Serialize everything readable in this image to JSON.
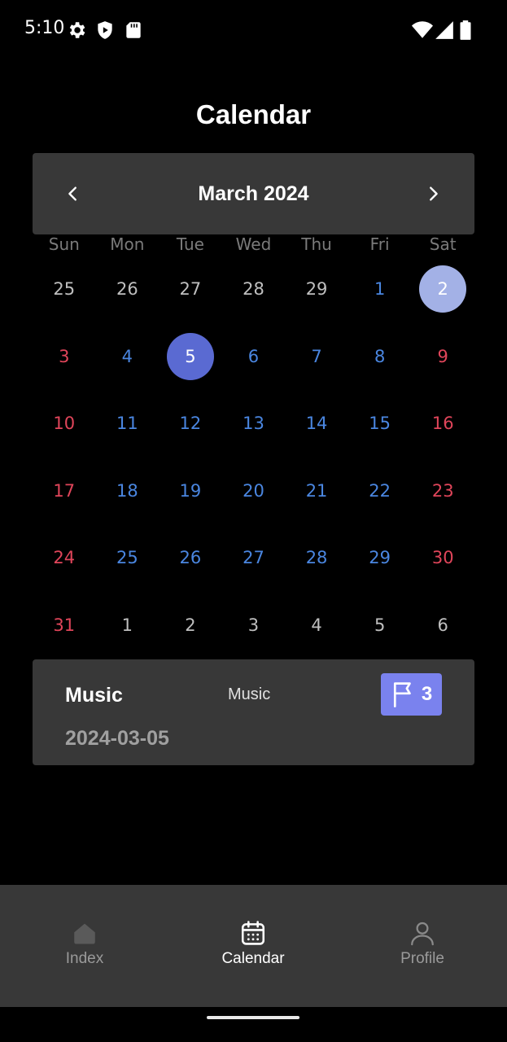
{
  "status_bar": {
    "time": "5:10"
  },
  "page": {
    "title": "Calendar"
  },
  "calendar": {
    "month_label": "March 2024",
    "weekdays": [
      "Sun",
      "Mon",
      "Tue",
      "Wed",
      "Thu",
      "Fri",
      "Sat"
    ],
    "days": [
      {
        "n": "25",
        "c": "grey"
      },
      {
        "n": "26",
        "c": "grey"
      },
      {
        "n": "27",
        "c": "grey"
      },
      {
        "n": "28",
        "c": "grey"
      },
      {
        "n": "29",
        "c": "grey"
      },
      {
        "n": "1",
        "c": "blue"
      },
      {
        "n": "2",
        "c": "grey",
        "s": "light"
      },
      {
        "n": "3",
        "c": "red"
      },
      {
        "n": "4",
        "c": "blue"
      },
      {
        "n": "5",
        "c": "blue",
        "s": "today"
      },
      {
        "n": "6",
        "c": "blue"
      },
      {
        "n": "7",
        "c": "blue"
      },
      {
        "n": "8",
        "c": "blue"
      },
      {
        "n": "9",
        "c": "red"
      },
      {
        "n": "10",
        "c": "red"
      },
      {
        "n": "11",
        "c": "blue"
      },
      {
        "n": "12",
        "c": "blue"
      },
      {
        "n": "13",
        "c": "blue"
      },
      {
        "n": "14",
        "c": "blue"
      },
      {
        "n": "15",
        "c": "blue"
      },
      {
        "n": "16",
        "c": "red"
      },
      {
        "n": "17",
        "c": "red"
      },
      {
        "n": "18",
        "c": "blue"
      },
      {
        "n": "19",
        "c": "blue"
      },
      {
        "n": "20",
        "c": "blue"
      },
      {
        "n": "21",
        "c": "blue"
      },
      {
        "n": "22",
        "c": "blue"
      },
      {
        "n": "23",
        "c": "red"
      },
      {
        "n": "24",
        "c": "red"
      },
      {
        "n": "25",
        "c": "blue"
      },
      {
        "n": "26",
        "c": "blue"
      },
      {
        "n": "27",
        "c": "blue"
      },
      {
        "n": "28",
        "c": "blue"
      },
      {
        "n": "29",
        "c": "blue"
      },
      {
        "n": "30",
        "c": "red"
      },
      {
        "n": "31",
        "c": "red"
      },
      {
        "n": "1",
        "c": "grey"
      },
      {
        "n": "2",
        "c": "grey"
      },
      {
        "n": "3",
        "c": "grey"
      },
      {
        "n": "4",
        "c": "grey"
      },
      {
        "n": "5",
        "c": "grey"
      },
      {
        "n": "6",
        "c": "grey"
      }
    ]
  },
  "event": {
    "title": "Music",
    "category": "Music",
    "date": "2024-03-05",
    "badge_count": "3"
  },
  "bottom_nav": {
    "items": [
      {
        "label": "Index",
        "icon": "home-icon",
        "active": false
      },
      {
        "label": "Calendar",
        "icon": "calendar-icon",
        "active": true
      },
      {
        "label": "Profile",
        "icon": "person-icon",
        "active": false
      }
    ]
  },
  "colors": {
    "background": "#000000",
    "card": "#383838",
    "weekday_blue": "#4a86e0",
    "weekend_red": "#e0455a",
    "today_circle": "#5a6ad2",
    "selected_circle": "#a3b1e6",
    "badge": "#7a82ee"
  }
}
